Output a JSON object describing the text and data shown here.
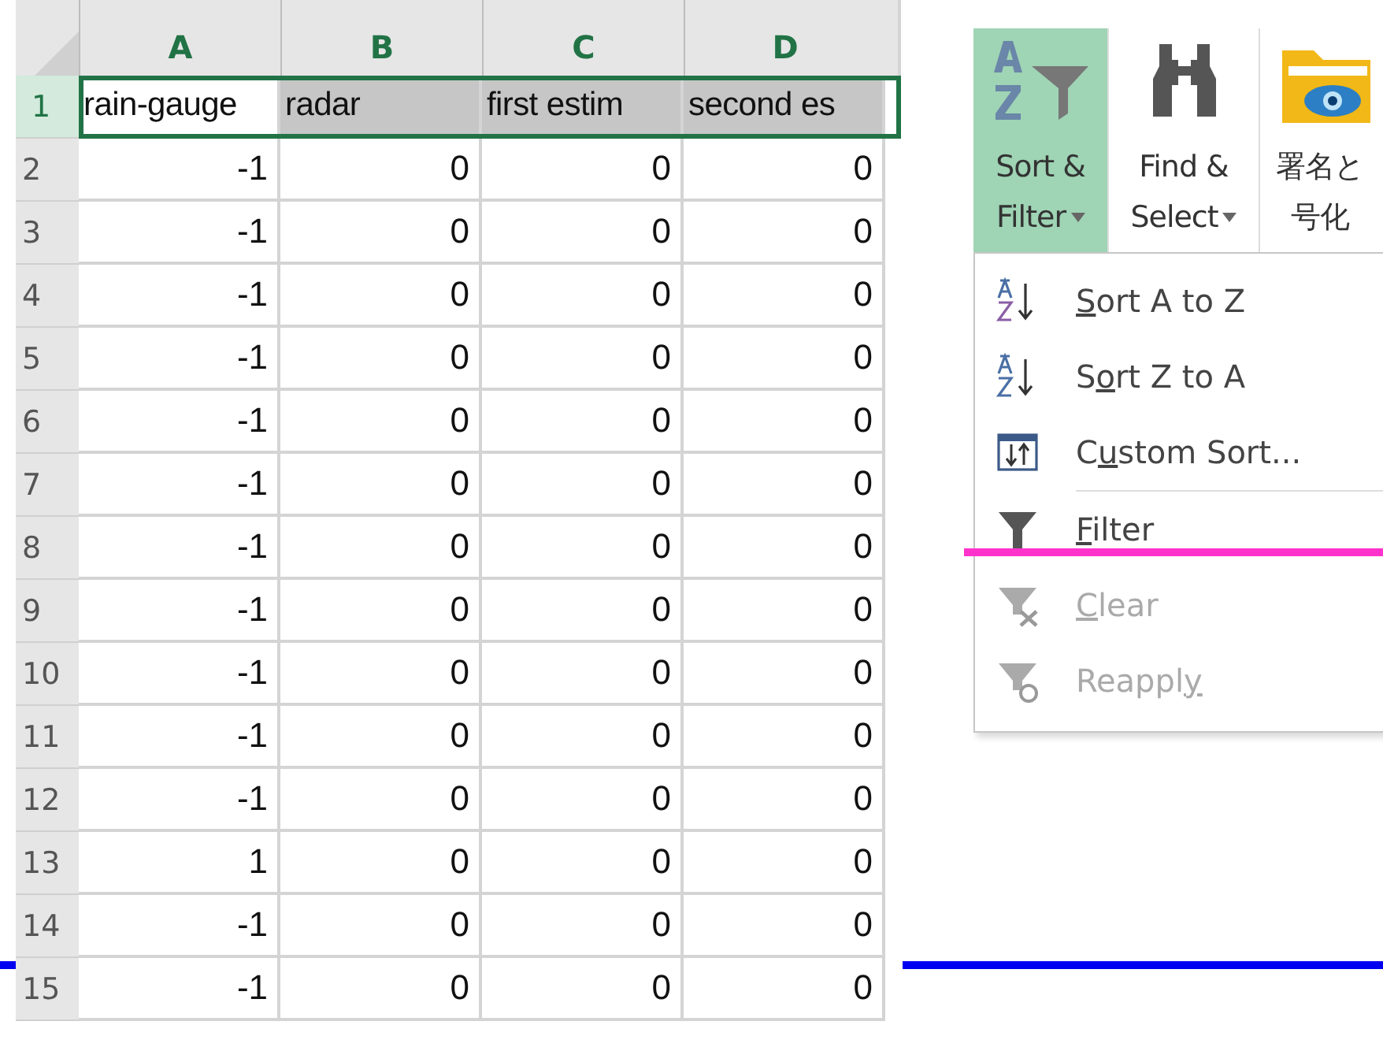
{
  "sheet": {
    "columns": [
      {
        "label": "A",
        "selected": true
      },
      {
        "label": "B",
        "selected": true
      },
      {
        "label": "C",
        "selected": true
      },
      {
        "label": "D",
        "selected": true
      }
    ],
    "rows": [
      {
        "number": "1",
        "selected": true,
        "cells": [
          "rain-gauge",
          "radar",
          "first estim",
          "second es"
        ]
      },
      {
        "number": "2",
        "selected": false,
        "cells": [
          "-1",
          "0",
          "0",
          "0"
        ]
      },
      {
        "number": "3",
        "selected": false,
        "cells": [
          "-1",
          "0",
          "0",
          "0"
        ]
      },
      {
        "number": "4",
        "selected": false,
        "cells": [
          "-1",
          "0",
          "0",
          "0"
        ]
      },
      {
        "number": "5",
        "selected": false,
        "cells": [
          "-1",
          "0",
          "0",
          "0"
        ]
      },
      {
        "number": "6",
        "selected": false,
        "cells": [
          "-1",
          "0",
          "0",
          "0"
        ]
      },
      {
        "number": "7",
        "selected": false,
        "cells": [
          "-1",
          "0",
          "0",
          "0"
        ]
      },
      {
        "number": "8",
        "selected": false,
        "cells": [
          "-1",
          "0",
          "0",
          "0"
        ]
      },
      {
        "number": "9",
        "selected": false,
        "cells": [
          "-1",
          "0",
          "0",
          "0"
        ]
      },
      {
        "number": "10",
        "selected": false,
        "cells": [
          "-1",
          "0",
          "0",
          "0"
        ]
      },
      {
        "number": "11",
        "selected": false,
        "cells": [
          "-1",
          "0",
          "0",
          "0"
        ]
      },
      {
        "number": "12",
        "selected": false,
        "cells": [
          "-1",
          "0",
          "0",
          "0"
        ]
      },
      {
        "number": "13",
        "selected": false,
        "cells": [
          "1",
          "0",
          "0",
          "0"
        ]
      },
      {
        "number": "14",
        "selected": false,
        "cells": [
          "-1",
          "0",
          "0",
          "0"
        ]
      },
      {
        "number": "15",
        "selected": false,
        "cells": [
          "-1",
          "0",
          "0",
          "0"
        ]
      }
    ]
  },
  "ribbon": {
    "buttons": [
      {
        "kind": "sort",
        "lines": [
          "Sort &",
          "Filter"
        ],
        "dropdown": true,
        "selected": true
      },
      {
        "kind": "find",
        "lines": [
          "Find &",
          "Select"
        ],
        "dropdown": true,
        "selected": false
      },
      {
        "kind": "folder",
        "lines": [
          "署名と",
          "号化"
        ],
        "dropdown": false,
        "selected": false
      }
    ]
  },
  "menu": {
    "items": [
      {
        "kind": "sort-az",
        "key": "S",
        "after": "ort A to Z",
        "disabled": false
      },
      {
        "kind": "sort-za",
        "before": "S",
        "key": "o",
        "after": "rt Z to A",
        "disabled": false
      },
      {
        "kind": "custom",
        "before": "C",
        "key": "u",
        "after": "stom Sort...",
        "disabled": false
      },
      {
        "kind": "filter",
        "key": "F",
        "after": "ilter",
        "disabled": false
      },
      {
        "kind": "clear",
        "key": "C",
        "after": "lear",
        "disabled": true
      },
      {
        "kind": "reapply",
        "before": "Reappl",
        "key": "y",
        "disabled": true
      }
    ]
  }
}
